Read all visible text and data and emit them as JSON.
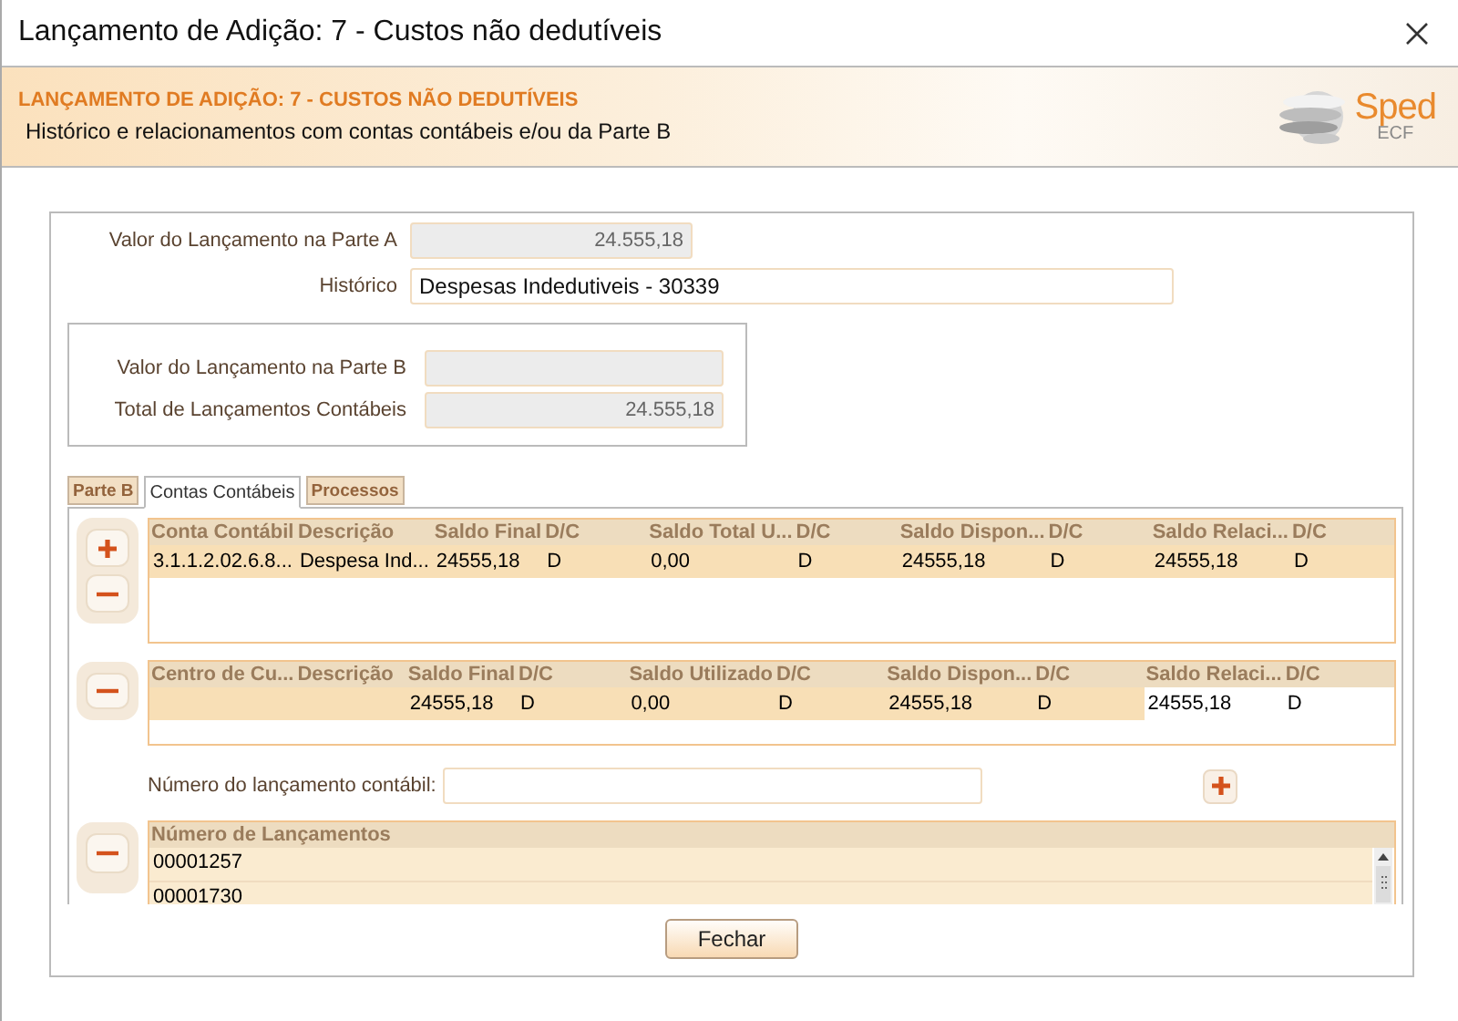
{
  "window": {
    "title": "Lançamento de Adição: 7 - Custos não dedutíveis"
  },
  "header": {
    "title": "LANÇAMENTO DE ADIÇÃO: 7 - CUSTOS NÃO DEDUTÍVEIS",
    "subtitle": "Histórico e relacionamentos com contas contábeis e/ou da Parte B",
    "logo": {
      "name": "Sped",
      "sub": "ECF"
    }
  },
  "fields": [
    {
      "kind": "number",
      "label": "Valor do Lançamento na Parte A",
      "value": "24.555,18",
      "disabled": true
    },
    {
      "kind": "text",
      "label": "Histórico",
      "value": "Despesas Indedutiveis - 30339",
      "disabled": false
    }
  ],
  "parte_b_box": {
    "fields": [
      {
        "kind": "number",
        "label": "Valor do Lançamento na Parte B",
        "disabled": true
      },
      {
        "kind": "number",
        "label": "Total de Lançamentos Contábeis",
        "value": "24.555,18",
        "disabled": true
      }
    ]
  },
  "tabs": [
    {
      "label": "Parte B",
      "selected": false
    },
    {
      "label": "Contas Contábeis",
      "selected": true
    },
    {
      "label": "Processos",
      "selected": false
    }
  ],
  "accounts_grid": {
    "actions": [
      {
        "kind": "add"
      },
      {
        "kind": "remove"
      }
    ],
    "columns": [
      "Conta Contábil",
      "Descrição",
      "Saldo Final",
      "D/C",
      "Saldo Total U...",
      "D/C",
      "Saldo Dispon...",
      "D/C",
      "Saldo Relaci...",
      "D/C"
    ],
    "rows": [
      {
        "cells": [
          {
            "text": "3.1.1.2.02.6.8...",
            "editable": false
          },
          {
            "text": "Despesa Ind...",
            "editable": false
          },
          {
            "text": "24555,18",
            "editable": false
          },
          {
            "text": "D",
            "editable": false
          },
          {
            "text": "0,00",
            "editable": false
          },
          {
            "text": "D",
            "editable": false
          },
          {
            "text": "24555,18",
            "editable": false
          },
          {
            "text": "D",
            "editable": false
          },
          {
            "text": "24555,18",
            "editable": false
          },
          {
            "text": "D",
            "editable": false
          }
        ]
      }
    ]
  },
  "cost_center_grid": {
    "actions": [
      {
        "kind": "remove"
      }
    ],
    "columns": [
      "Centro de Cu...",
      "Descrição",
      "Saldo Final",
      "D/C",
      "Saldo Utilizado",
      "D/C",
      "Saldo Dispon...",
      "D/C",
      "Saldo Relaci...",
      "D/C"
    ],
    "rows": [
      {
        "cells": [
          {
            "editable": false
          },
          {
            "editable": false
          },
          {
            "text": "24555,18",
            "editable": false
          },
          {
            "text": "D",
            "editable": false
          },
          {
            "text": "0,00",
            "editable": false
          },
          {
            "text": "D",
            "editable": false
          },
          {
            "text": "24555,18",
            "editable": false
          },
          {
            "text": "D",
            "editable": false
          },
          {
            "text": "24555,18",
            "editable": true
          },
          {
            "text": "D",
            "editable": true
          }
        ]
      }
    ]
  },
  "entry_number": {
    "label": "Número do lançamento contábil:",
    "action": {
      "kind": "add"
    }
  },
  "entries_grid": {
    "actions": [
      {
        "kind": "remove"
      }
    ],
    "columns": [
      "Número de Lançamentos"
    ],
    "rows": [
      {
        "cells": [
          {
            "text": "00001257",
            "editable": false
          }
        ]
      },
      {
        "cells": [
          {
            "text": "00001730",
            "editable": false
          }
        ]
      }
    ]
  },
  "buttons": [
    {
      "label": "Fechar"
    }
  ]
}
